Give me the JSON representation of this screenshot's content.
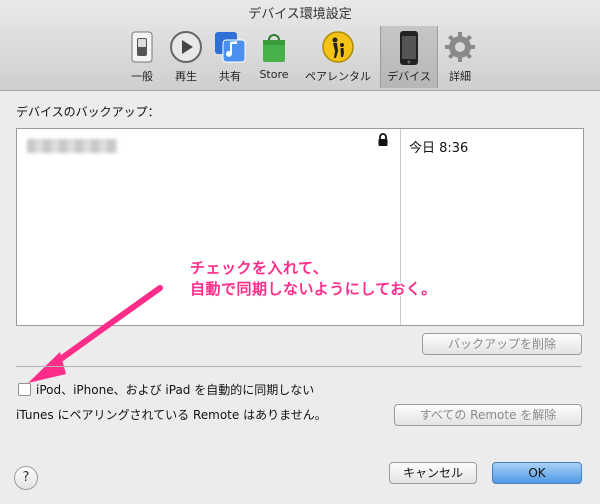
{
  "window": {
    "title": "デバイス環境設定"
  },
  "toolbar": {
    "items": [
      {
        "label": "一般",
        "icon": "general-switch-icon"
      },
      {
        "label": "再生",
        "icon": "playback-icon"
      },
      {
        "label": "共有",
        "icon": "sharing-icon"
      },
      {
        "label": "Store",
        "icon": "store-bag-icon"
      },
      {
        "label": "ペアレンタル",
        "icon": "parental-icon"
      },
      {
        "label": "デバイス",
        "icon": "iphone-icon",
        "selected": true
      },
      {
        "label": "詳細",
        "icon": "gear-icon"
      }
    ]
  },
  "backup": {
    "section_label": "デバイスのバックアップ：",
    "rows": [
      {
        "date": "今日 8:36",
        "locked": true
      }
    ],
    "delete_button": "バックアップを削除"
  },
  "annotation": {
    "line1": "チェックを入れて、",
    "line2": "自動で同期しないようにしておく。",
    "color": "#ff2d8a"
  },
  "sync": {
    "checkbox_label": "iPod、iPhone、および iPad を自動的に同期しない",
    "checked": false
  },
  "remote": {
    "text": "iTunes にペアリングされている Remote はありません。",
    "unpair_button": "すべての Remote を解除"
  },
  "footer": {
    "help_label": "?",
    "cancel_label": "キャンセル",
    "ok_label": "OK"
  }
}
